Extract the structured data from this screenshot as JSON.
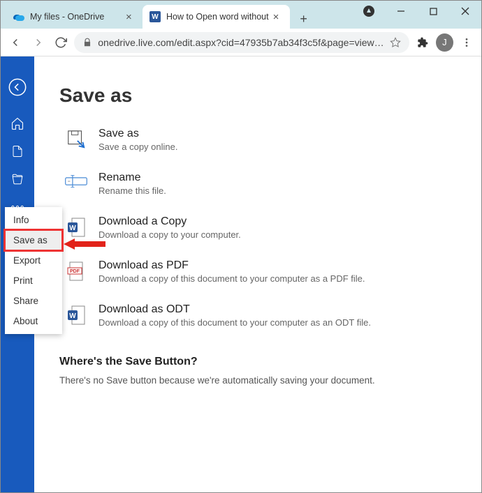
{
  "browser": {
    "tabs": [
      {
        "title": "My files - OneDrive"
      },
      {
        "title": "How to Open word without"
      }
    ],
    "url": "onedrive.live.com/edit.aspx?cid=47935b7ab34f3c5f&page=view…",
    "avatar_initial": "J"
  },
  "page": {
    "heading": "Save as",
    "options": [
      {
        "title": "Save as",
        "desc": "Save a copy online."
      },
      {
        "title": "Rename",
        "desc": "Rename this file."
      },
      {
        "title": "Download a Copy",
        "desc": "Download a copy to your computer."
      },
      {
        "title": "Download as PDF",
        "desc": "Download a copy of this document to your computer as a PDF file."
      },
      {
        "title": "Download as ODT",
        "desc": "Download a copy of this document to your computer as an ODT file."
      }
    ],
    "section": {
      "heading": "Where's the Save Button?",
      "body": "There's no Save button because we're automatically saving your document."
    }
  },
  "flyout": {
    "items": [
      "Info",
      "Save as",
      "Export",
      "Print",
      "Share",
      "About"
    ],
    "highlighted": "Save as"
  }
}
